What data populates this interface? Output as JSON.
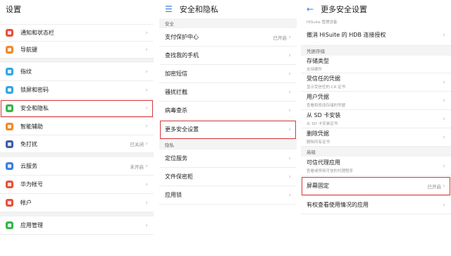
{
  "panel1": {
    "title": "设置",
    "items": [
      {
        "label": "通知和状态栏",
        "icon": "notification-icon",
        "color": "#e5533d"
      },
      {
        "label": "导航键",
        "icon": "navigation-key-icon",
        "color": "#f08a2c"
      },
      {
        "label": "指纹",
        "icon": "fingerprint-icon",
        "color": "#35a7e0"
      },
      {
        "label": "锁屏和密码",
        "icon": "lock-icon",
        "color": "#35a7e0"
      },
      {
        "label": "安全和隐私",
        "icon": "shield-icon",
        "color": "#39b54a"
      },
      {
        "label": "智能辅助",
        "icon": "hand-icon",
        "color": "#f08a2c"
      },
      {
        "label": "免打扰",
        "icon": "moon-icon",
        "color": "#3f5ea8",
        "status": "已关闭"
      },
      {
        "label": "云服务",
        "icon": "cloud-icon",
        "color": "#3e7fe0",
        "status": "未开启"
      },
      {
        "label": "华为帐号",
        "icon": "huawei-icon",
        "color": "#e5533d"
      },
      {
        "label": "帐户",
        "icon": "account-icon",
        "color": "#e5533d"
      },
      {
        "label": "应用管理",
        "icon": "apps-icon",
        "color": "#39b54a"
      }
    ]
  },
  "panel2": {
    "title": "安全和隐私",
    "section1": "安全",
    "items1": [
      {
        "label": "支付保护中心",
        "status": "已开启"
      },
      {
        "label": "查找我的手机"
      },
      {
        "label": "加密短信"
      },
      {
        "label": "骚扰拦截"
      },
      {
        "label": "病毒查杀"
      },
      {
        "label": "更多安全设置"
      }
    ],
    "section2": "隐私",
    "items2": [
      {
        "label": "定位服务"
      },
      {
        "label": "文件保密柜"
      },
      {
        "label": "应用锁"
      }
    ]
  },
  "panel3": {
    "title": "更多安全设置",
    "top_sub": "HiSuite 管理设备",
    "revoke": "撤消 HiSuite 的 HDB 连接授权",
    "section1": "凭据存储",
    "items1": [
      {
        "label": "存储类型",
        "sub": "支持硬件"
      },
      {
        "label": "受信任的凭据",
        "sub": "显示受信任的 CA 证书"
      },
      {
        "label": "用户凭据",
        "sub": "查看和修改存储的凭据"
      },
      {
        "label": "从 SD 卡安装",
        "sub": "从 SD 卡安装证书"
      },
      {
        "label": "删除凭据",
        "sub": "删除所有证书"
      }
    ],
    "section2": "高级",
    "items2": [
      {
        "label": "可信代理应用",
        "sub": "查看或停用可信的代理程序"
      },
      {
        "label": "屏幕固定",
        "status": "已开启"
      },
      {
        "label": "有权查看使用情况的应用"
      }
    ]
  },
  "colors": {
    "accent": "#3e7fe0",
    "highlight": "#d33a3a"
  }
}
